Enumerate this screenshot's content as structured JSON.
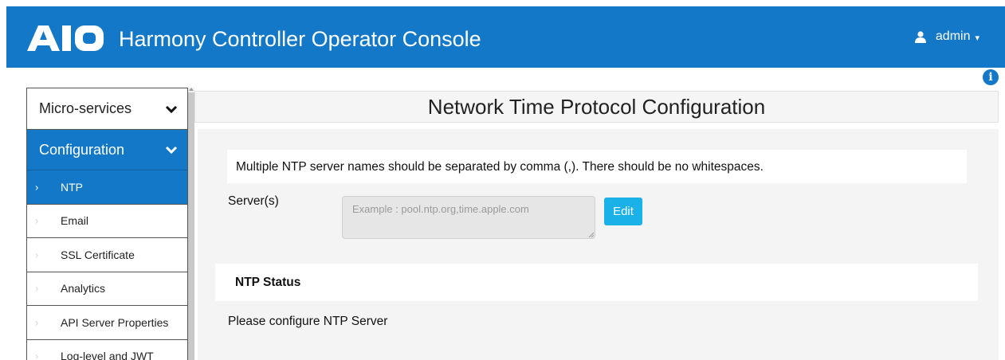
{
  "header": {
    "logo_text": "A10",
    "title": "Harmony Controller Operator Console",
    "user": "admin",
    "user_icon": "user-icon",
    "caret_icon": "caret-down-icon",
    "brand_color": "#1378c8"
  },
  "info_icon": "info-icon",
  "sidebar": {
    "sections": [
      {
        "label": "Micro-services",
        "expanded": false
      },
      {
        "label": "Configuration",
        "expanded": true
      }
    ],
    "items": [
      {
        "label": "NTP",
        "active": true
      },
      {
        "label": "Email",
        "active": false
      },
      {
        "label": "SSL Certificate",
        "active": false
      },
      {
        "label": "Analytics",
        "active": false
      },
      {
        "label": "API Server Properties",
        "active": false
      },
      {
        "label": "Log-level and JWT",
        "active": false
      }
    ],
    "arrow_glyph": "›"
  },
  "main": {
    "title": "Network Time Protocol Configuration",
    "notice": "Multiple NTP server names should be separated by comma (,). There should be no whitespaces.",
    "server_label": "Server(s)",
    "server_placeholder": "Example : pool.ntp.org,time.apple.com",
    "server_value": "",
    "edit_label": "Edit",
    "status_heading": "NTP Status",
    "status_message": "Please configure NTP Server",
    "accent_color": "#1ab0e8"
  }
}
